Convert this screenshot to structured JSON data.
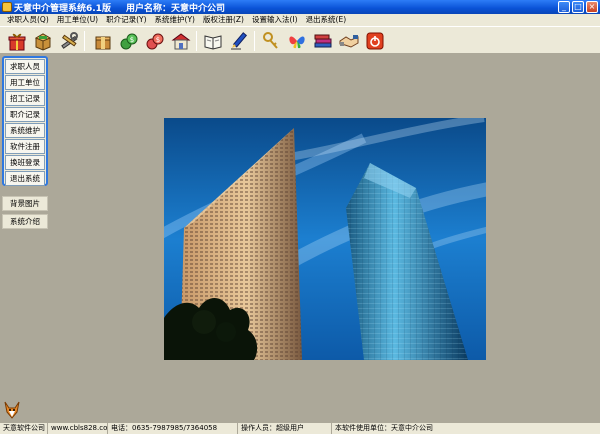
{
  "window": {
    "title": "天意中介管理系统6.1版",
    "user_label": "用户名称：天意中介公司",
    "min_glyph": "_",
    "max_glyph": "□",
    "close_glyph": "×"
  },
  "menu": [
    "求职人员(Q)",
    "用工单位(U)",
    "职介记录(Y)",
    "系统维护(Y)",
    "版权注册(Z)",
    "设置输入法(I)",
    "退出系统(E)"
  ],
  "toolbar_icons": [
    "gift-icon",
    "box-icon",
    "tools-icon",
    "package-icon",
    "money-icon",
    "money-red-icon",
    "house-icon",
    "book-icon",
    "pen-icon",
    "keys-icon",
    "butterfly-icon",
    "books-icon",
    "handshake-icon",
    "power-icon"
  ],
  "sidebar": {
    "items": [
      "求职人员",
      "用工单位",
      "招工记录",
      "职介记录",
      "系统维护",
      "软件注册",
      "换班登录",
      "退出系统"
    ],
    "extra": [
      "背景图片",
      "系统介绍"
    ]
  },
  "status": {
    "company": "天意软件公司",
    "website": "www.cbls828.com",
    "phone": "电话：0635-7987985/7364058",
    "operator": "操作人员：超级用户",
    "licensee": "本软件使用单位：天意中介公司"
  },
  "colors": {
    "titlebar": "#0a52d6",
    "panel_border": "#2f78e0",
    "desktop": "#aca899",
    "sky": "#1c7fd0"
  }
}
